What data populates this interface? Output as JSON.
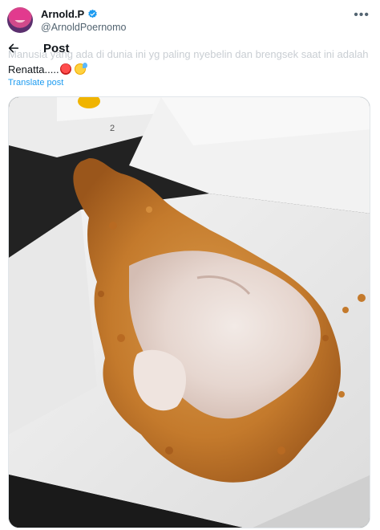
{
  "tweet": {
    "author_name": "Arnold.P",
    "author_handle": "@ArnoldPoernomo",
    "more_glyph": "•••",
    "text_faded": "Manusia yang ada di dunia ini yg paling nyebelin dan brengsek saat ini adalah",
    "text_main": "Renatta.....",
    "emojis": [
      "angry-face",
      "hot-sweat-face"
    ],
    "translate_label": "Translate post"
  },
  "nav": {
    "title": "Post"
  },
  "media": {
    "box_number": "2"
  },
  "colors": {
    "verified": "#1d9bf0",
    "link": "#1d9bf0",
    "text": "#0f1419",
    "muted": "#536471"
  }
}
